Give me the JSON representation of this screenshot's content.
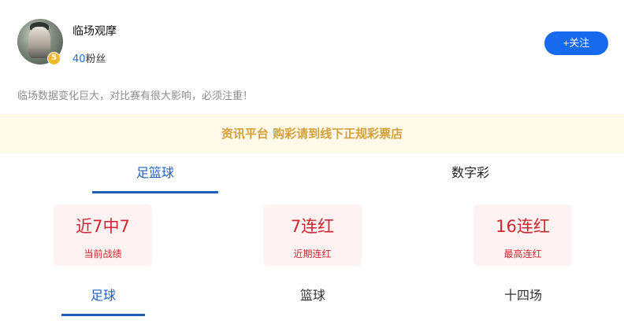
{
  "profile": {
    "name": "临场观摩",
    "level": "5",
    "fans_count": "40",
    "fans_label": "粉丝",
    "follow_label": "+关注"
  },
  "bio": "临场数据变化巨大，对比赛有很大影响，必须注重！",
  "notice": "资讯平台 购彩请到线下正规彩票店",
  "main_tabs": [
    {
      "label": "足篮球",
      "active": true
    },
    {
      "label": "数字彩",
      "active": false
    }
  ],
  "stats": [
    {
      "value": "近7中7",
      "label": "当前战绩"
    },
    {
      "value": "7连红",
      "label": "近期连红"
    },
    {
      "value": "16连红",
      "label": "最高连红"
    }
  ],
  "sub_tabs": [
    {
      "label": "足球",
      "active": true
    },
    {
      "label": "篮球",
      "active": false
    },
    {
      "label": "十四场",
      "active": false
    }
  ],
  "colors": {
    "accent": "#1f5fb8",
    "follow_button": "#1769ee",
    "notice_bg": "#fff9ea",
    "notice_text": "#d4a03a",
    "stat_bg": "#fff2f2",
    "stat_text": "#d0252f"
  }
}
